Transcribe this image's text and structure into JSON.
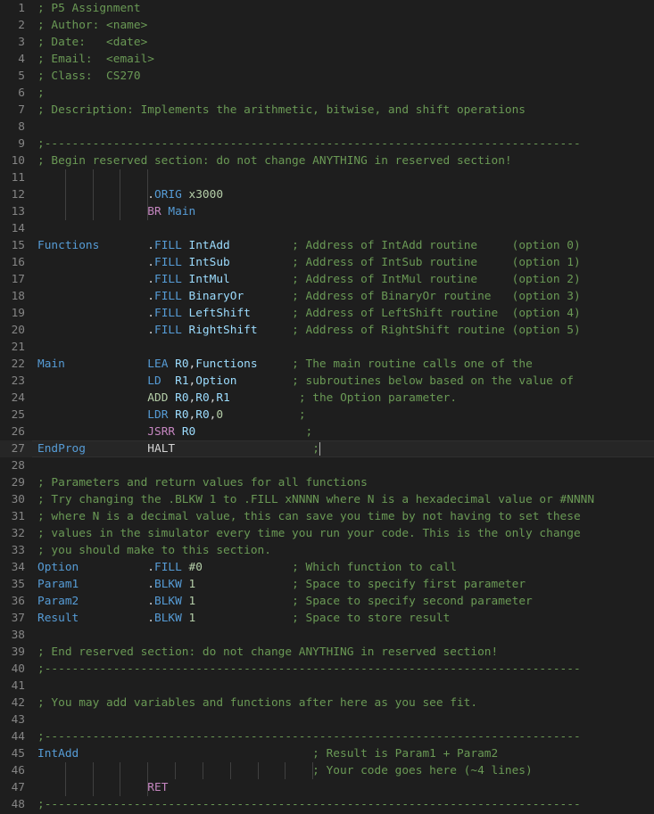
{
  "editor": {
    "lines": [
      {
        "n": "1",
        "tokens": [
          {
            "t": "; P5 Assignment",
            "c": "cm"
          }
        ]
      },
      {
        "n": "2",
        "tokens": [
          {
            "t": "; Author: <name>",
            "c": "cm"
          }
        ]
      },
      {
        "n": "3",
        "tokens": [
          {
            "t": "; Date:   <date>",
            "c": "cm"
          }
        ]
      },
      {
        "n": "4",
        "tokens": [
          {
            "t": "; Email:  <email>",
            "c": "cm"
          }
        ]
      },
      {
        "n": "5",
        "tokens": [
          {
            "t": "; Class:  CS270",
            "c": "cm"
          }
        ]
      },
      {
        "n": "6",
        "tokens": [
          {
            "t": ";",
            "c": "cm"
          }
        ]
      },
      {
        "n": "7",
        "tokens": [
          {
            "t": "; Description: Implements the arithmetic, bitwise, and shift operations",
            "c": "cm"
          }
        ]
      },
      {
        "n": "8",
        "tokens": []
      },
      {
        "n": "9",
        "tokens": [
          {
            "t": ";------------------------------------------------------------------------------",
            "c": "cm"
          }
        ]
      },
      {
        "n": "10",
        "tokens": [
          {
            "t": "; Begin reserved section: do not change ANYTHING in reserved section!",
            "c": "cm"
          }
        ]
      },
      {
        "n": "11",
        "tokens": [],
        "guides": 4
      },
      {
        "n": "12",
        "tokens": [
          {
            "t": "                .",
            "c": "dot"
          },
          {
            "t": "ORIG",
            "c": "op"
          },
          {
            "t": " x3000",
            "c": "nm"
          }
        ],
        "guides": 4
      },
      {
        "n": "13",
        "tokens": [
          {
            "t": "                ",
            "c": "tx"
          },
          {
            "t": "BR",
            "c": "kw"
          },
          {
            "t": " Main",
            "c": "lb"
          }
        ],
        "guides": 4
      },
      {
        "n": "14",
        "tokens": []
      },
      {
        "n": "15",
        "tokens": [
          {
            "t": "Functions",
            "c": "lb"
          },
          {
            "t": "       .",
            "c": "dot"
          },
          {
            "t": "FILL",
            "c": "op"
          },
          {
            "t": " IntAdd",
            "c": "rg"
          },
          {
            "t": "         ; Address of IntAdd routine     (option 0)",
            "c": "cm"
          }
        ]
      },
      {
        "n": "16",
        "tokens": [
          {
            "t": "                .",
            "c": "dot"
          },
          {
            "t": "FILL",
            "c": "op"
          },
          {
            "t": " IntSub",
            "c": "rg"
          },
          {
            "t": "         ; Address of IntSub routine     (option 1)",
            "c": "cm"
          }
        ]
      },
      {
        "n": "17",
        "tokens": [
          {
            "t": "                .",
            "c": "dot"
          },
          {
            "t": "FILL",
            "c": "op"
          },
          {
            "t": " IntMul",
            "c": "rg"
          },
          {
            "t": "         ; Address of IntMul routine     (option 2)",
            "c": "cm"
          }
        ]
      },
      {
        "n": "18",
        "tokens": [
          {
            "t": "                .",
            "c": "dot"
          },
          {
            "t": "FILL",
            "c": "op"
          },
          {
            "t": " BinaryOr",
            "c": "rg"
          },
          {
            "t": "       ; Address of BinaryOr routine   (option 3)",
            "c": "cm"
          }
        ]
      },
      {
        "n": "19",
        "tokens": [
          {
            "t": "                .",
            "c": "dot"
          },
          {
            "t": "FILL",
            "c": "op"
          },
          {
            "t": " LeftShift",
            "c": "rg"
          },
          {
            "t": "      ; Address of LeftShift routine  (option 4)",
            "c": "cm"
          }
        ]
      },
      {
        "n": "20",
        "tokens": [
          {
            "t": "                .",
            "c": "dot"
          },
          {
            "t": "FILL",
            "c": "op"
          },
          {
            "t": " RightShift",
            "c": "rg"
          },
          {
            "t": "     ; Address of RightShift routine (option 5)",
            "c": "cm"
          }
        ]
      },
      {
        "n": "21",
        "tokens": []
      },
      {
        "n": "22",
        "tokens": [
          {
            "t": "Main",
            "c": "lb"
          },
          {
            "t": "            ",
            "c": "tx"
          },
          {
            "t": "LEA",
            "c": "op"
          },
          {
            "t": " R0",
            "c": "rg"
          },
          {
            "t": ",",
            "c": "tx"
          },
          {
            "t": "Functions",
            "c": "rg"
          },
          {
            "t": "     ; The main routine calls one of the",
            "c": "cm"
          }
        ]
      },
      {
        "n": "23",
        "tokens": [
          {
            "t": "                ",
            "c": "tx"
          },
          {
            "t": "LD",
            "c": "op"
          },
          {
            "t": "  R1",
            "c": "rg"
          },
          {
            "t": ",",
            "c": "tx"
          },
          {
            "t": "Option",
            "c": "rg"
          },
          {
            "t": "        ; subroutines below based on the value of",
            "c": "cm"
          }
        ]
      },
      {
        "n": "24",
        "tokens": [
          {
            "t": "                ",
            "c": "tx"
          },
          {
            "t": "ADD",
            "c": "dr"
          },
          {
            "t": " R0",
            "c": "rg"
          },
          {
            "t": ",",
            "c": "tx"
          },
          {
            "t": "R0",
            "c": "rg"
          },
          {
            "t": ",",
            "c": "tx"
          },
          {
            "t": "R1",
            "c": "rg"
          },
          {
            "t": "          ; the Option parameter.",
            "c": "cm"
          }
        ]
      },
      {
        "n": "25",
        "tokens": [
          {
            "t": "                ",
            "c": "tx"
          },
          {
            "t": "LDR",
            "c": "op"
          },
          {
            "t": " R0",
            "c": "rg"
          },
          {
            "t": ",",
            "c": "tx"
          },
          {
            "t": "R0",
            "c": "rg"
          },
          {
            "t": ",",
            "c": "tx"
          },
          {
            "t": "0",
            "c": "nm"
          },
          {
            "t": "           ;",
            "c": "cm"
          }
        ]
      },
      {
        "n": "26",
        "tokens": [
          {
            "t": "                ",
            "c": "tx"
          },
          {
            "t": "JSRR",
            "c": "kw"
          },
          {
            "t": " R0",
            "c": "rg"
          },
          {
            "t": "                ;",
            "c": "cm"
          }
        ]
      },
      {
        "n": "27",
        "tokens": [
          {
            "t": "EndProg",
            "c": "lb"
          },
          {
            "t": "         ",
            "c": "tx"
          },
          {
            "t": "HALT",
            "c": "tx"
          },
          {
            "t": "                    ;",
            "c": "cm"
          }
        ],
        "current": true
      },
      {
        "n": "28",
        "tokens": []
      },
      {
        "n": "29",
        "tokens": [
          {
            "t": "; Parameters and return values for all functions",
            "c": "cm"
          }
        ]
      },
      {
        "n": "30",
        "tokens": [
          {
            "t": "; Try changing the .BLKW 1 to .FILL xNNNN where N is a hexadecimal value or #NNNN",
            "c": "cm"
          }
        ]
      },
      {
        "n": "31",
        "tokens": [
          {
            "t": "; where N is a decimal value, this can save you time by not having to set these",
            "c": "cm"
          }
        ]
      },
      {
        "n": "32",
        "tokens": [
          {
            "t": "; values in the simulator every time you run your code. This is the only change",
            "c": "cm"
          }
        ]
      },
      {
        "n": "33",
        "tokens": [
          {
            "t": "; you should make to this section.",
            "c": "cm"
          }
        ]
      },
      {
        "n": "34",
        "tokens": [
          {
            "t": "Option",
            "c": "lb"
          },
          {
            "t": "          .",
            "c": "dot"
          },
          {
            "t": "FILL",
            "c": "op"
          },
          {
            "t": " #0",
            "c": "nm"
          },
          {
            "t": "             ; Which function to call",
            "c": "cm"
          }
        ]
      },
      {
        "n": "35",
        "tokens": [
          {
            "t": "Param1",
            "c": "lb"
          },
          {
            "t": "          .",
            "c": "dot"
          },
          {
            "t": "BLKW",
            "c": "op"
          },
          {
            "t": " 1",
            "c": "nm"
          },
          {
            "t": "              ; Space to specify first parameter",
            "c": "cm"
          }
        ]
      },
      {
        "n": "36",
        "tokens": [
          {
            "t": "Param2",
            "c": "lb"
          },
          {
            "t": "          .",
            "c": "dot"
          },
          {
            "t": "BLKW",
            "c": "op"
          },
          {
            "t": " 1",
            "c": "nm"
          },
          {
            "t": "              ; Space to specify second parameter",
            "c": "cm"
          }
        ]
      },
      {
        "n": "37",
        "tokens": [
          {
            "t": "Result",
            "c": "lb"
          },
          {
            "t": "          .",
            "c": "dot"
          },
          {
            "t": "BLKW",
            "c": "op"
          },
          {
            "t": " 1",
            "c": "nm"
          },
          {
            "t": "              ; Space to store result",
            "c": "cm"
          }
        ]
      },
      {
        "n": "38",
        "tokens": []
      },
      {
        "n": "39",
        "tokens": [
          {
            "t": "; End reserved section: do not change ANYTHING in reserved section!",
            "c": "cm"
          }
        ]
      },
      {
        "n": "40",
        "tokens": [
          {
            "t": ";------------------------------------------------------------------------------",
            "c": "cm"
          }
        ]
      },
      {
        "n": "41",
        "tokens": []
      },
      {
        "n": "42",
        "tokens": [
          {
            "t": "; You may add variables and functions after here as you see fit.",
            "c": "cm"
          }
        ]
      },
      {
        "n": "43",
        "tokens": []
      },
      {
        "n": "44",
        "tokens": [
          {
            "t": ";------------------------------------------------------------------------------",
            "c": "cm"
          }
        ]
      },
      {
        "n": "45",
        "tokens": [
          {
            "t": "IntAdd",
            "c": "lb"
          },
          {
            "t": "                                  ; Result is Param1 + Param2",
            "c": "cm"
          }
        ]
      },
      {
        "n": "46",
        "tokens": [
          {
            "t": "                                        ; Your code goes here (~4 lines)",
            "c": "cm"
          }
        ],
        "guides": 10
      },
      {
        "n": "47",
        "tokens": [
          {
            "t": "                ",
            "c": "tx"
          },
          {
            "t": "RET",
            "c": "kw"
          }
        ],
        "guides": 4
      },
      {
        "n": "48",
        "tokens": [
          {
            "t": ";------------------------------------------------------------------------------",
            "c": "cm"
          }
        ]
      }
    ]
  }
}
